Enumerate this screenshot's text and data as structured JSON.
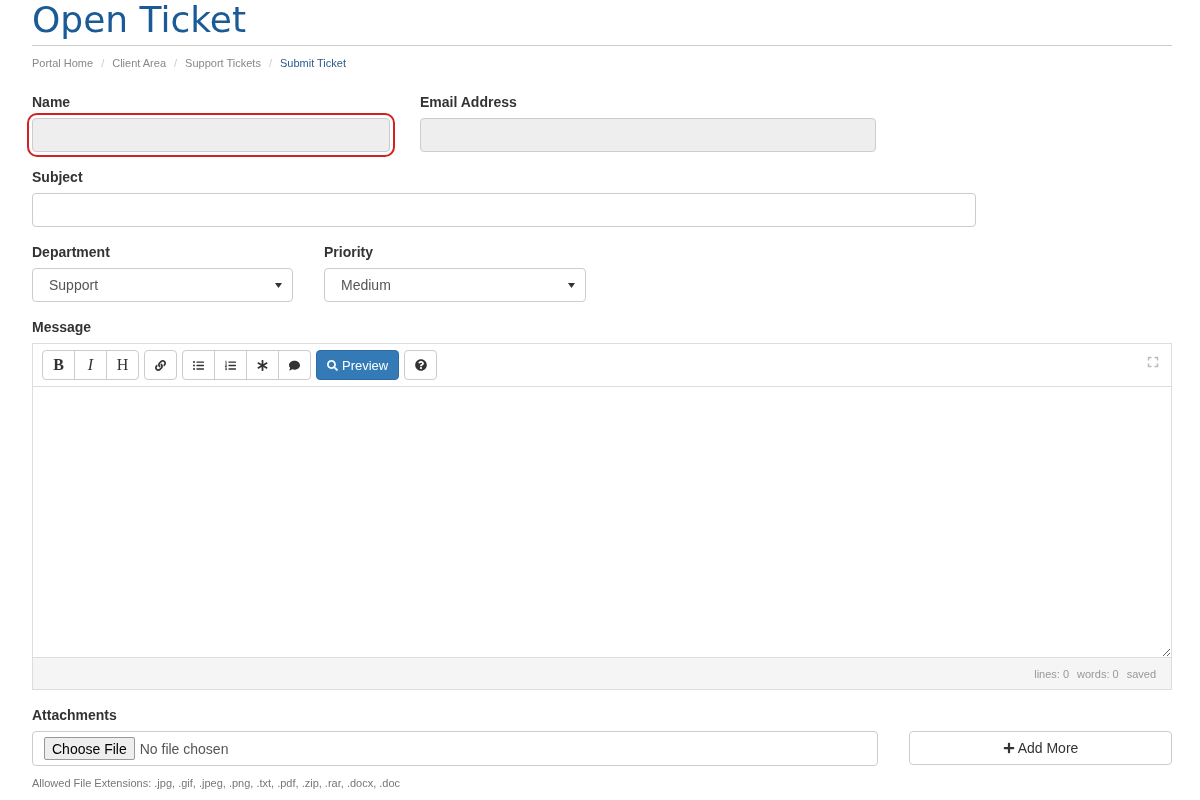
{
  "page_title": "Open Ticket",
  "breadcrumb": [
    {
      "label": "Portal Home",
      "selected": false
    },
    {
      "label": "Client Area",
      "selected": false
    },
    {
      "label": "Support Tickets",
      "selected": false
    },
    {
      "label": "Submit Ticket",
      "selected": true
    }
  ],
  "breadcrumb_separator": "/",
  "name_field": {
    "label": "Name",
    "disabled": true,
    "highlighted": true
  },
  "email_field": {
    "label": "Email Address",
    "disabled": true,
    "highlighted": false
  },
  "subject_field": {
    "label": "Subject"
  },
  "department": {
    "label": "Department",
    "value": "Support"
  },
  "priority": {
    "label": "Priority",
    "value": "Medium"
  },
  "message": {
    "label": "Message",
    "format_buttons": [
      "B",
      "I",
      "H"
    ],
    "preview_button": "Preview",
    "status": [
      "lines: 0",
      "words: 0",
      "saved"
    ]
  },
  "attachments": {
    "label": "Attachments",
    "choose_button": "Choose File",
    "file_status": "No file chosen",
    "add_button": "Add More",
    "help": "Allowed File Extensions: .jpg, .gif, .jpeg, .png, .txt, .pdf, .zip, .rar, .docx, .doc"
  }
}
